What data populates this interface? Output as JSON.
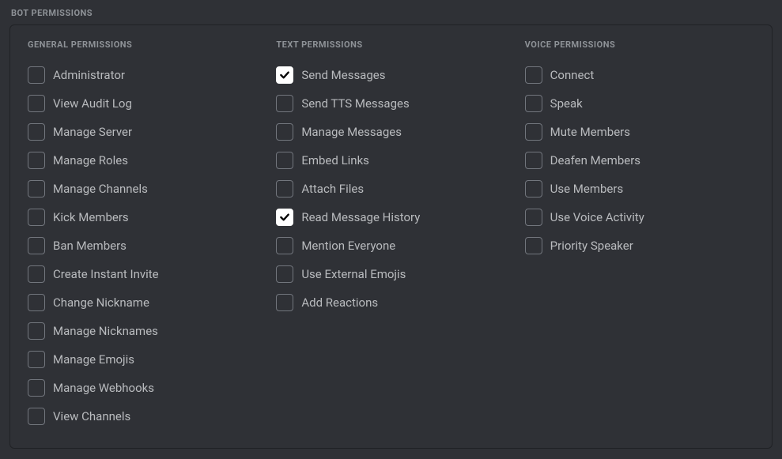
{
  "section_title": "BOT PERMISSIONS",
  "columns": [
    {
      "header": "GENERAL PERMISSIONS",
      "items": [
        {
          "label": "Administrator",
          "checked": false
        },
        {
          "label": "View Audit Log",
          "checked": false
        },
        {
          "label": "Manage Server",
          "checked": false
        },
        {
          "label": "Manage Roles",
          "checked": false
        },
        {
          "label": "Manage Channels",
          "checked": false
        },
        {
          "label": "Kick Members",
          "checked": false
        },
        {
          "label": "Ban Members",
          "checked": false
        },
        {
          "label": "Create Instant Invite",
          "checked": false
        },
        {
          "label": "Change Nickname",
          "checked": false
        },
        {
          "label": "Manage Nicknames",
          "checked": false
        },
        {
          "label": "Manage Emojis",
          "checked": false
        },
        {
          "label": "Manage Webhooks",
          "checked": false
        },
        {
          "label": "View Channels",
          "checked": false
        }
      ]
    },
    {
      "header": "TEXT PERMISSIONS",
      "items": [
        {
          "label": "Send Messages",
          "checked": true
        },
        {
          "label": "Send TTS Messages",
          "checked": false
        },
        {
          "label": "Manage Messages",
          "checked": false
        },
        {
          "label": "Embed Links",
          "checked": false
        },
        {
          "label": "Attach Files",
          "checked": false
        },
        {
          "label": "Read Message History",
          "checked": true
        },
        {
          "label": "Mention Everyone",
          "checked": false
        },
        {
          "label": "Use External Emojis",
          "checked": false
        },
        {
          "label": "Add Reactions",
          "checked": false
        }
      ]
    },
    {
      "header": "VOICE PERMISSIONS",
      "items": [
        {
          "label": "Connect",
          "checked": false
        },
        {
          "label": "Speak",
          "checked": false
        },
        {
          "label": "Mute Members",
          "checked": false
        },
        {
          "label": "Deafen Members",
          "checked": false
        },
        {
          "label": "Use Members",
          "checked": false
        },
        {
          "label": "Use Voice Activity",
          "checked": false
        },
        {
          "label": "Priority Speaker",
          "checked": false
        }
      ]
    }
  ]
}
